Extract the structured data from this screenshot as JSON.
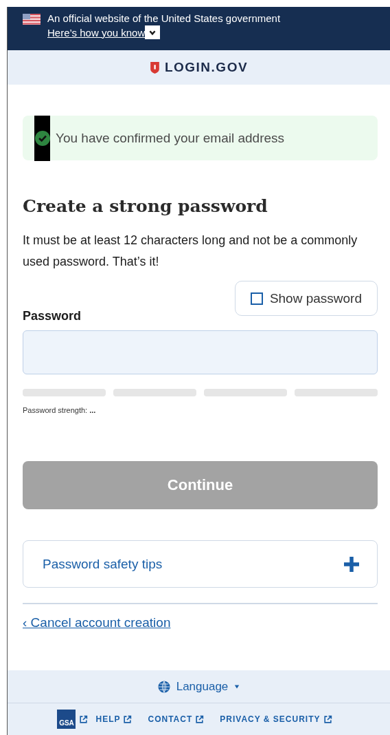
{
  "gov_banner": {
    "text": "An official website of the United States government",
    "link": "Here’s how you know",
    "expanded": false
  },
  "header": {
    "logo": "LOGIN.GOV"
  },
  "alert": {
    "kind": "success",
    "text": "You have confirmed your email address"
  },
  "heading": "Create a strong password",
  "intro": "It must be at least 12 characters long and not be a commonly used password. That’s it!",
  "show_password": {
    "label": "Show password",
    "checked": false
  },
  "password_field": {
    "label": "Password"
  },
  "strength": {
    "label": "Password strength:",
    "value": "...",
    "segments": [
      {
        "filled": false
      },
      {
        "filled": false
      },
      {
        "filled": false
      },
      {
        "filled": false
      }
    ]
  },
  "continue_button": {
    "label": "Continue",
    "disabled": true
  },
  "accordion": {
    "label": "Password safety tips",
    "expanded": false
  },
  "cancel_link": "‹ Cancel account creation",
  "footer": {
    "language": "Language",
    "links": [
      "HELP",
      "CONTACT",
      "PRIVACY & SECURITY"
    ],
    "logo": "GSA"
  }
}
